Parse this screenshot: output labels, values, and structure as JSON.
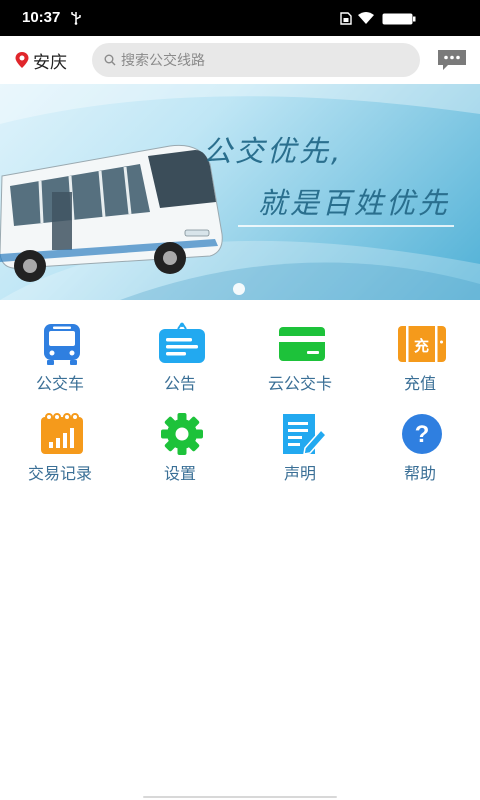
{
  "status_bar": {
    "time": "10:37"
  },
  "header": {
    "city": "安庆",
    "search_placeholder": "搜索公交线路"
  },
  "banner": {
    "line1": "公交优先,",
    "line2": "就是百姓优先"
  },
  "menu": {
    "items": [
      {
        "label": "公交车",
        "icon": "bus-icon",
        "color": "#2f7fe0"
      },
      {
        "label": "公告",
        "icon": "announcement-icon",
        "color": "#22a9f0"
      },
      {
        "label": "云公交卡",
        "icon": "bus-card-icon",
        "color": "#1dc23a"
      },
      {
        "label": "充值",
        "icon": "recharge-icon",
        "color": "#f59a1b"
      },
      {
        "label": "交易记录",
        "icon": "transaction-record-icon",
        "color": "#f59a1b"
      },
      {
        "label": "设置",
        "icon": "settings-gear-icon",
        "color": "#1dc23a"
      },
      {
        "label": "声明",
        "icon": "statement-doc-icon",
        "color": "#22a9f0"
      },
      {
        "label": "帮助",
        "icon": "help-icon",
        "color": "#2f7fe0"
      }
    ]
  }
}
